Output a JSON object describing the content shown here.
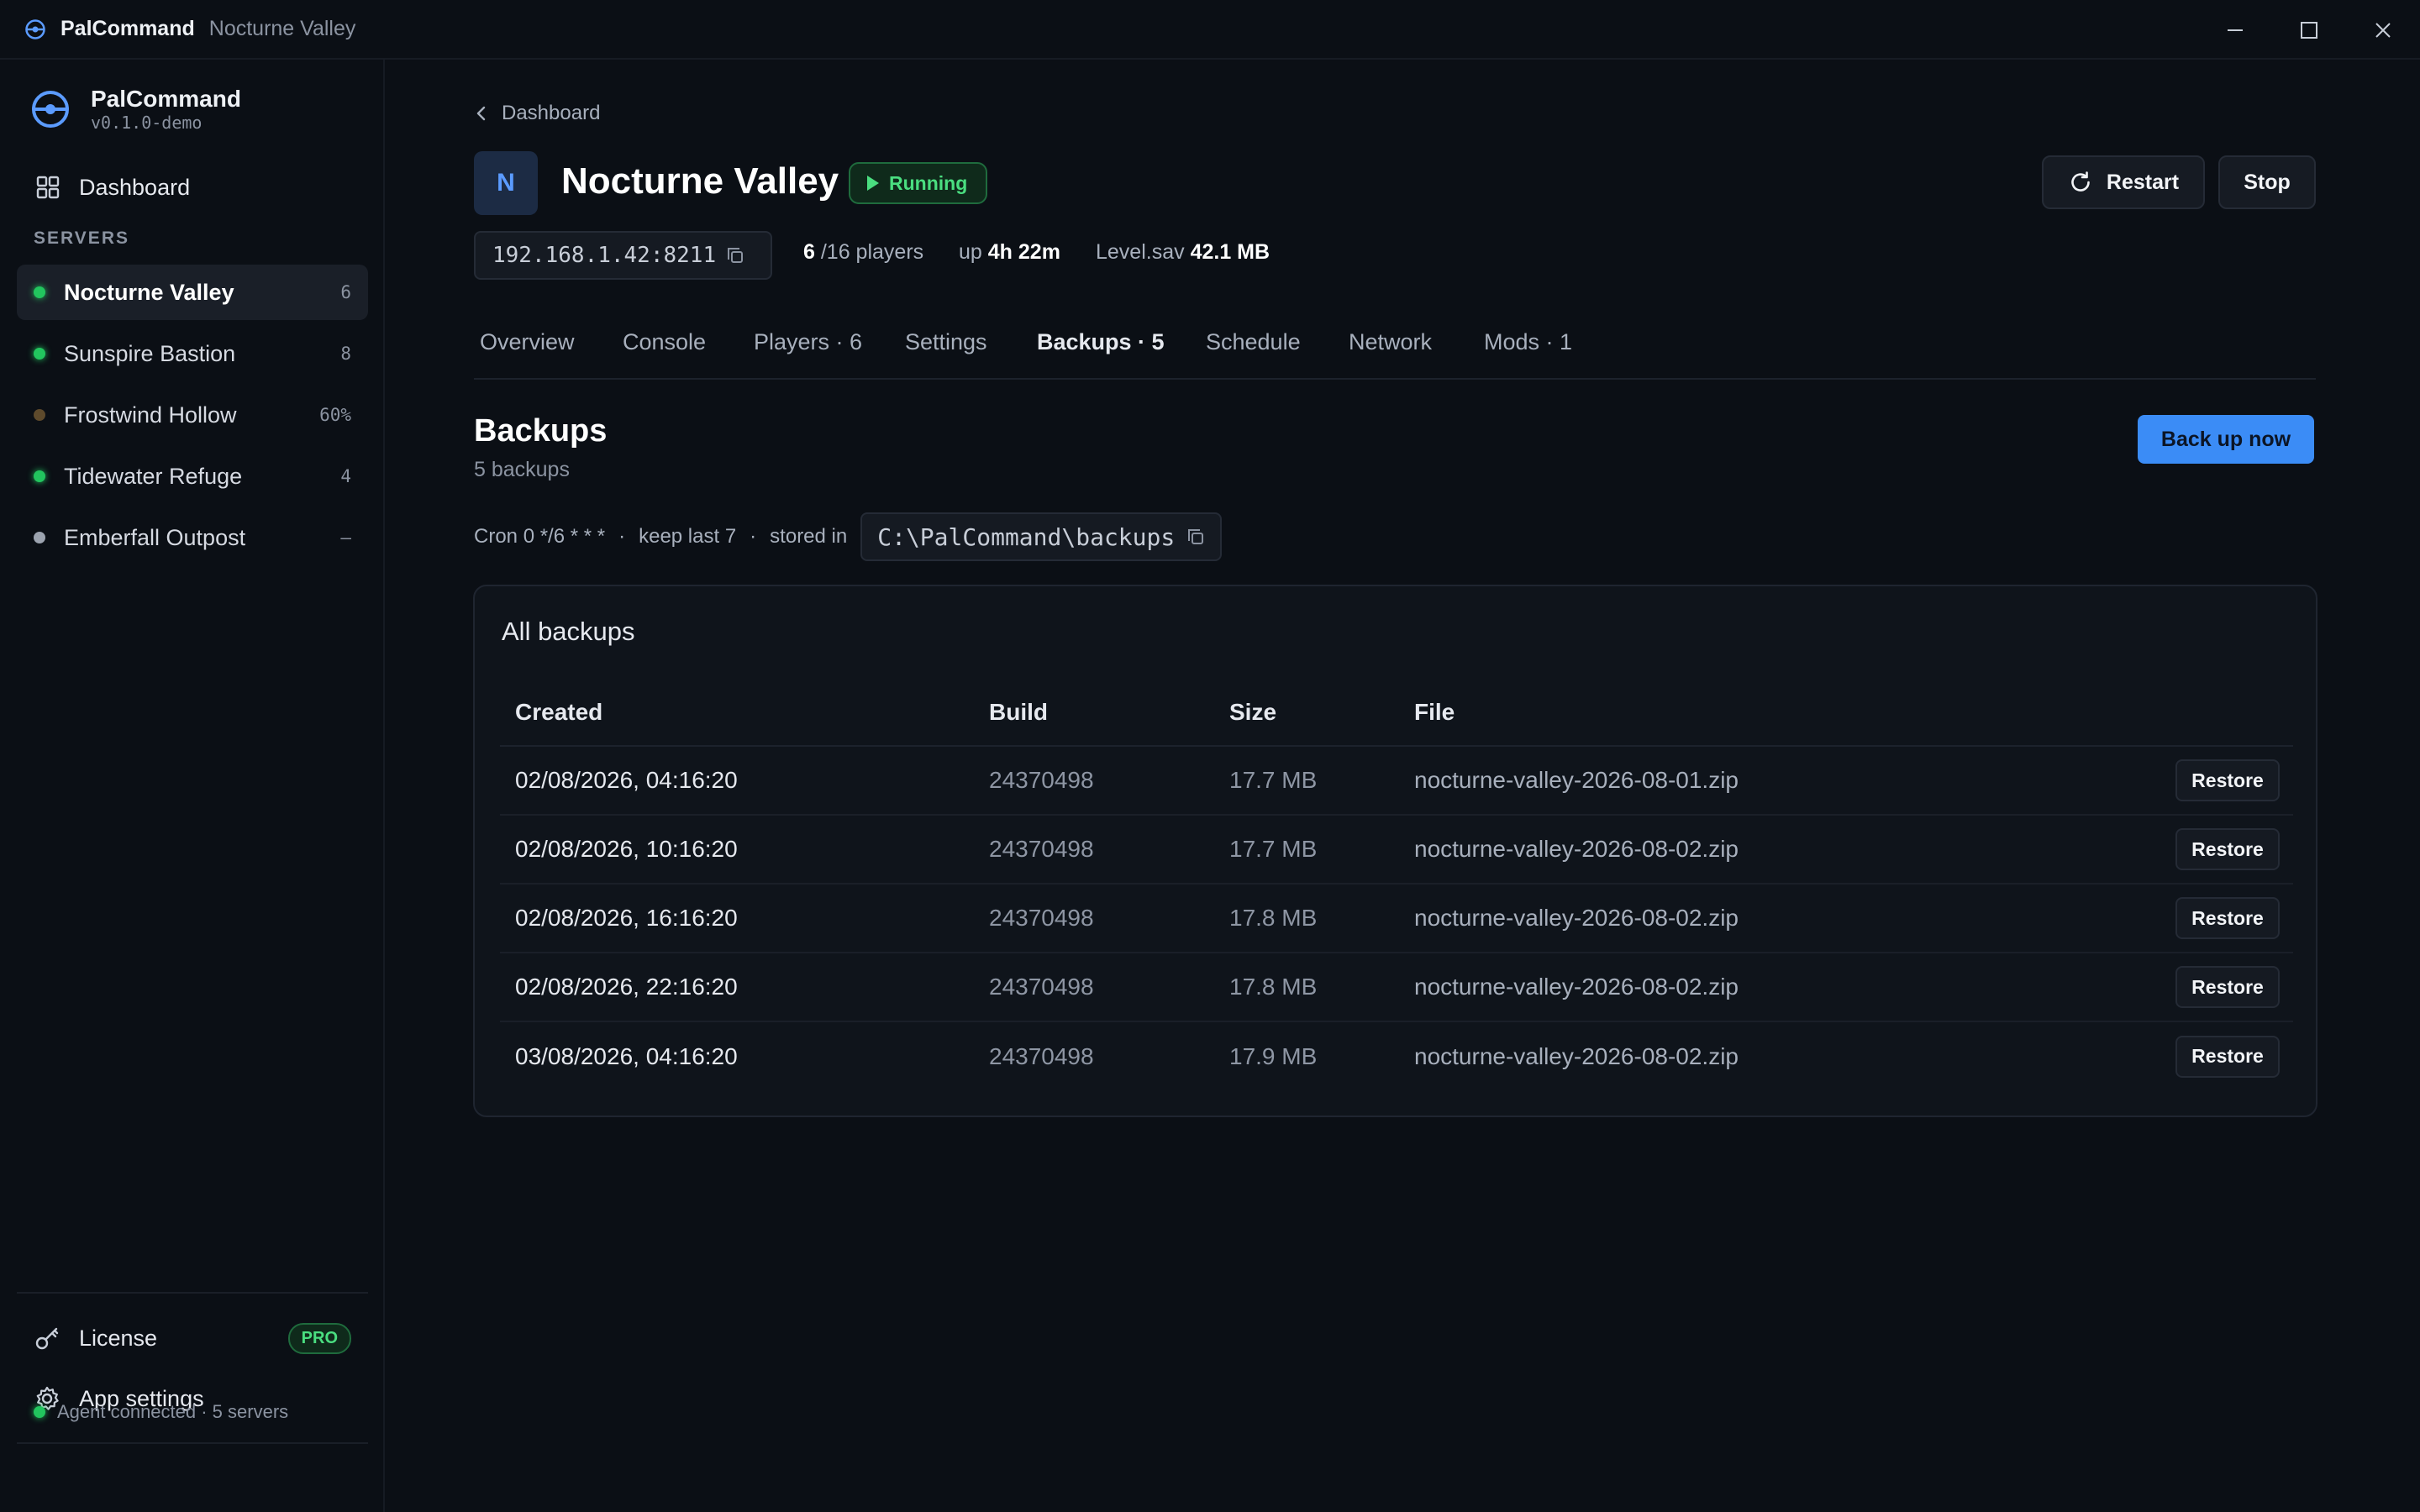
{
  "titlebar": {
    "app": "PalCommand",
    "context": "Nocturne Valley"
  },
  "sidebar": {
    "brand": "PalCommand",
    "version": "v0.1.0-demo",
    "dashboard": "Dashboard",
    "section": "SERVERS",
    "servers": [
      {
        "name": "Nocturne Valley",
        "count": "6",
        "status": "running",
        "color": "#22c55e"
      },
      {
        "name": "Sunspire Bastion",
        "count": "8",
        "status": "running",
        "color": "#22c55e"
      },
      {
        "name": "Frostwind Hollow",
        "count": "60%",
        "status": "starting",
        "color": "#5e4a2c"
      },
      {
        "name": "Tidewater Refuge",
        "count": "4",
        "status": "running",
        "color": "#22c55e"
      },
      {
        "name": "Emberfall Outpost",
        "count": "–",
        "status": "stopped",
        "color": "#9ca3af"
      }
    ],
    "license": "License",
    "license_badge": "PRO",
    "app_settings": "App settings",
    "agent_status": "Agent connected · 5 servers"
  },
  "server": {
    "breadcrumb": "Dashboard",
    "initial": "N",
    "title": "Nocturne Valley",
    "status": "Running",
    "restart": "Restart",
    "stop": "Stop",
    "address": "192.168.1.42:8211",
    "players_now": "6",
    "players_max": " /16 players",
    "up_label": "up",
    "uptime": "4h 22m",
    "save_label": "Level.sav",
    "save_size": "42.1 MB"
  },
  "tabs": [
    {
      "label": "Overview"
    },
    {
      "label": "Console"
    },
    {
      "label": "Players · 6"
    },
    {
      "label": "Settings"
    },
    {
      "label": "Backups · 5"
    },
    {
      "label": "Schedule"
    },
    {
      "label": "Network"
    },
    {
      "label": "Mods · 1"
    }
  ],
  "backups": {
    "title": "Backups",
    "count": "5 backups",
    "backup_now": "Back up now",
    "cron": "Cron 0 */6 * * *",
    "dot": "·",
    "keep": "keep last 7",
    "stored_in": "stored in",
    "path": "C:\\PalCommand\\backups",
    "card_title": "All backups",
    "columns": {
      "created": "Created",
      "build": "Build",
      "size": "Size",
      "file": "File"
    },
    "restore": "Restore",
    "rows": [
      {
        "created": "02/08/2026, 04:16:20",
        "build": "24370498",
        "size": "17.7 MB",
        "file": "nocturne-valley-2026-08-01.zip"
      },
      {
        "created": "02/08/2026, 10:16:20",
        "build": "24370498",
        "size": "17.7 MB",
        "file": "nocturne-valley-2026-08-02.zip"
      },
      {
        "created": "02/08/2026, 16:16:20",
        "build": "24370498",
        "size": "17.8 MB",
        "file": "nocturne-valley-2026-08-02.zip"
      },
      {
        "created": "02/08/2026, 22:16:20",
        "build": "24370498",
        "size": "17.8 MB",
        "file": "nocturne-valley-2026-08-02.zip"
      },
      {
        "created": "03/08/2026, 04:16:20",
        "build": "24370498",
        "size": "17.9 MB",
        "file": "nocturne-valley-2026-08-02.zip"
      }
    ]
  },
  "colors": {
    "accent": "#3b8cf6",
    "success": "#4ade80",
    "background": "#0b0f15"
  }
}
